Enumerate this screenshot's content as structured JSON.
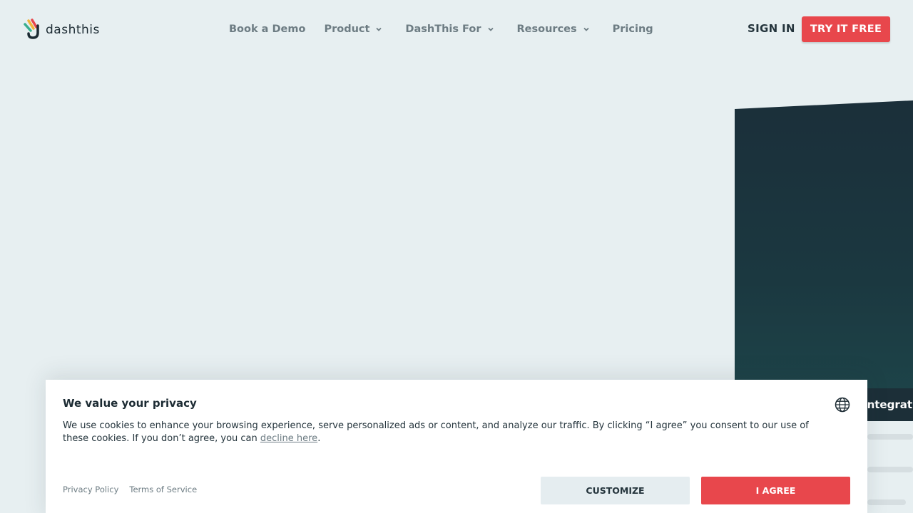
{
  "brand": {
    "name": "dashthis"
  },
  "nav": {
    "items": [
      {
        "label": "Book a Demo",
        "has_dropdown": false
      },
      {
        "label": "Product",
        "has_dropdown": true
      },
      {
        "label": "DashThis For",
        "has_dropdown": true
      },
      {
        "label": "Resources",
        "has_dropdown": true
      },
      {
        "label": "Pricing",
        "has_dropdown": false
      }
    ],
    "sign_in": "SIGN IN",
    "try_free": "TRY IT FREE"
  },
  "hero": {
    "tab_label": "Integrations"
  },
  "cookie_banner": {
    "title": "We value your privacy",
    "text_before_link": "We use cookies to enhance your browsing experience, serve personalized ads or content, and analyze our traffic. By clicking “I agree” you consent to our use of these cookies. If you don’t agree, you can ",
    "decline_link": "decline here",
    "text_after_link": ".",
    "privacy_policy": "Privacy Policy",
    "terms_of_service": "Terms of Service",
    "customize_label": "CUSTOMIZE",
    "agree_label": "I AGREE",
    "language_icon": "globe-icon"
  },
  "colors": {
    "background": "#e7eff1",
    "accent": "#e8474c",
    "dark_text": "#1c2b33",
    "muted_text": "#6d7c83",
    "hero_panel": "#1b2f3a"
  }
}
